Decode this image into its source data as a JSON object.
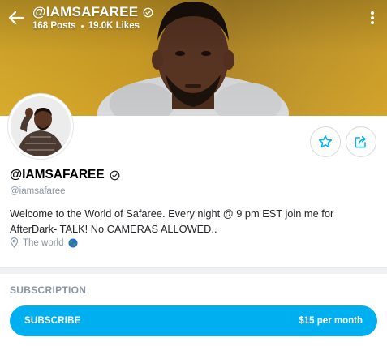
{
  "header": {
    "title": "@IAMSAFAREE",
    "posts": "168 Posts",
    "likes": "19.0K Likes"
  },
  "profile": {
    "name": "@IAMSAFAREE",
    "handle": "@iamsafaree",
    "bio": "Welcome to the World of Safaree. Every night @ 9 pm EST join me for AfterDark- TALK! No CAMERAS ALLOWED..",
    "location": "The world"
  },
  "subscription": {
    "section_title": "SUBSCRIPTION",
    "button_label": "SUBSCRIBE",
    "price": "$15 per month"
  },
  "icons": {
    "back": "arrow-left-icon",
    "verified": "verified-badge-icon",
    "more": "more-vertical-icon",
    "favorite": "star-icon",
    "share": "share-icon",
    "location": "location-pin-icon",
    "globe": "globe-icon"
  },
  "colors": {
    "accent": "#00aff0",
    "muted": "#8a96a3",
    "cover_gold": "#d4a42b"
  }
}
